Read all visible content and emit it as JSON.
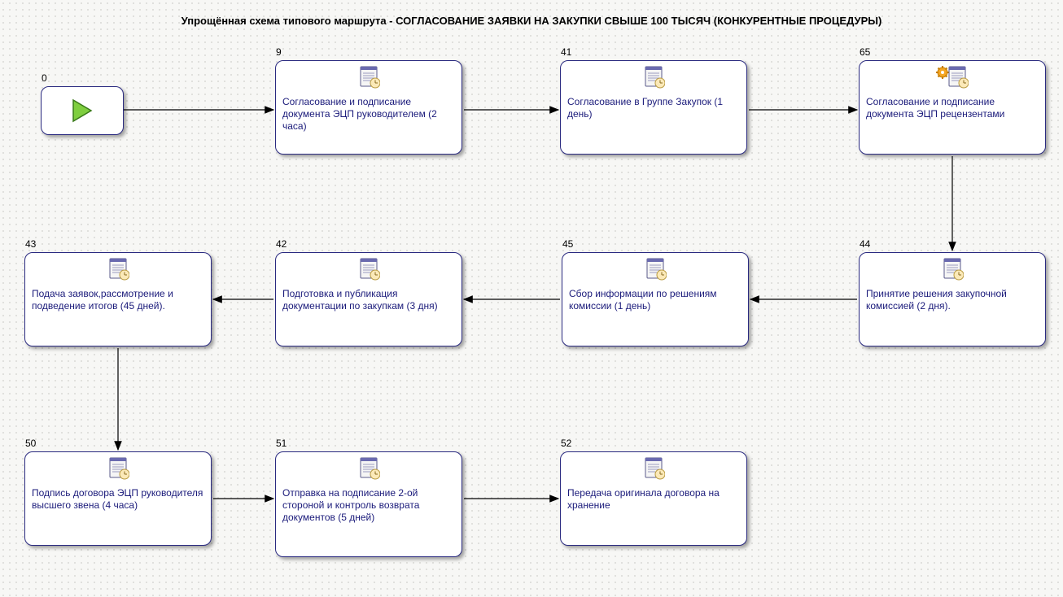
{
  "title": "Упрощённая схема типового маршрута - СОГЛАСОВАНИЕ ЗАЯВКИ НА ЗАКУПКИ СВЫШЕ 100 ТЫСЯЧ (КОНКУРЕНТНЫЕ ПРОЦЕДУРЫ)",
  "start": {
    "id": "0"
  },
  "nodes": {
    "n9": {
      "id": "9",
      "text": "Согласование и подписание документа ЭЦП руководителем (2 часа)",
      "icon": "document"
    },
    "n41": {
      "id": "41",
      "text": "Согласование в Группе Закупок (1 день)",
      "icon": "document"
    },
    "n65": {
      "id": "65",
      "text": "Согласование и подписание документа ЭЦП рецензентами",
      "icon": "document-gear"
    },
    "n44": {
      "id": "44",
      "text": "Принятие решения закупочной комиссией (2 дня).",
      "icon": "document"
    },
    "n45": {
      "id": "45",
      "text": "Сбор информации по решениям комиссии (1 день)",
      "icon": "document"
    },
    "n42": {
      "id": "42",
      "text": "Подготовка и публикация документации по закупкам (3 дня)",
      "icon": "document"
    },
    "n43": {
      "id": "43",
      "text": "Подача заявок,рассмотрение и подведение итогов (45 дней).",
      "icon": "document"
    },
    "n50": {
      "id": "50",
      "text": "Подпись договора ЭЦП руководителя высшего звена (4 часа)",
      "icon": "document"
    },
    "n51": {
      "id": "51",
      "text": "Отправка на подписание 2-ой стороной и контроль возврата документов (5 дней)",
      "icon": "document"
    },
    "n52": {
      "id": "52",
      "text": "Передача оригинала договора на хранение",
      "icon": "document"
    }
  },
  "chart_data": {
    "type": "flowchart",
    "title": "Упрощённая схема типового маршрута - СОГЛАСОВАНИЕ ЗАЯВКИ НА ЗАКУПКИ СВЫШЕ 100 ТЫСЯЧ (КОНКУРЕНТНЫЕ ПРОЦЕДУРЫ)",
    "nodes": [
      {
        "id": "0",
        "kind": "start"
      },
      {
        "id": "9",
        "kind": "task",
        "label": "Согласование и подписание документа ЭЦП руководителем (2 часа)"
      },
      {
        "id": "41",
        "kind": "task",
        "label": "Согласование в Группе Закупок (1 день)"
      },
      {
        "id": "65",
        "kind": "task",
        "label": "Согласование и подписание документа ЭЦП рецензентами"
      },
      {
        "id": "44",
        "kind": "task",
        "label": "Принятие решения закупочной комиссией (2 дня)."
      },
      {
        "id": "45",
        "kind": "task",
        "label": "Сбор информации по решениям комиссии (1 день)"
      },
      {
        "id": "42",
        "kind": "task",
        "label": "Подготовка и публикация документации по закупкам (3 дня)"
      },
      {
        "id": "43",
        "kind": "task",
        "label": "Подача заявок,рассмотрение и подведение итогов (45 дней)."
      },
      {
        "id": "50",
        "kind": "task",
        "label": "Подпись договора ЭЦП руководителя высшего звена (4 часа)"
      },
      {
        "id": "51",
        "kind": "task",
        "label": "Отправка на подписание 2-ой стороной и контроль возврата документов (5 дней)"
      },
      {
        "id": "52",
        "kind": "task",
        "label": "Передача оригинала договора на хранение"
      }
    ],
    "edges": [
      [
        "0",
        "9"
      ],
      [
        "9",
        "41"
      ],
      [
        "41",
        "65"
      ],
      [
        "65",
        "44"
      ],
      [
        "44",
        "45"
      ],
      [
        "45",
        "42"
      ],
      [
        "42",
        "43"
      ],
      [
        "43",
        "50"
      ],
      [
        "50",
        "51"
      ],
      [
        "51",
        "52"
      ]
    ]
  }
}
